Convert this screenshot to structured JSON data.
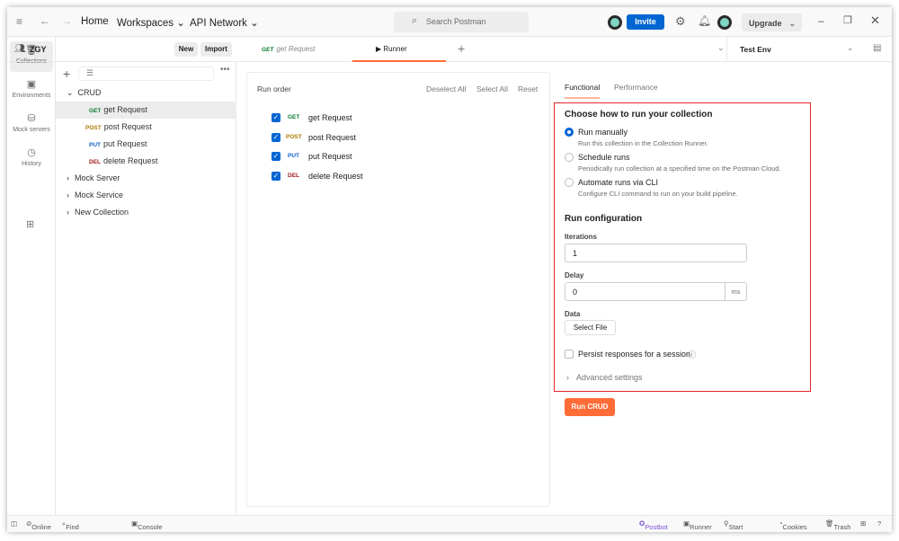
{
  "topbar": {
    "home": "Home",
    "workspaces": "Workspaces",
    "api_network": "API Network",
    "search_placeholder": "Search Postman",
    "invite": "Invite",
    "upgrade": "Upgrade"
  },
  "workspace": {
    "name": "ZGY",
    "new": "New",
    "import": "Import"
  },
  "tabs": [
    {
      "method": "GET",
      "label": "get Request"
    },
    {
      "label": "Runner"
    }
  ],
  "environment": "Test Env",
  "rail": [
    {
      "label": "Collections"
    },
    {
      "label": "Environments"
    },
    {
      "label": "Mock servers"
    },
    {
      "label": "History"
    }
  ],
  "tree": {
    "collection": "CRUD",
    "requests": [
      {
        "method": "GET",
        "name": "get Request"
      },
      {
        "method": "POST",
        "name": "post Request"
      },
      {
        "method": "PUT",
        "name": "put Request"
      },
      {
        "method": "DEL",
        "name": "delete Request"
      }
    ],
    "others": [
      "Mock Server",
      "Mock Service",
      "New Collection"
    ]
  },
  "run_order": {
    "title": "Run order",
    "deselect_all": "Deselect All",
    "select_all": "Select All",
    "reset": "Reset",
    "items": [
      {
        "method": "GET",
        "name": "get Request"
      },
      {
        "method": "POST",
        "name": "post Request"
      },
      {
        "method": "PUT",
        "name": "put Request"
      },
      {
        "method": "DEL",
        "name": "delete Request"
      }
    ]
  },
  "config": {
    "tab_functional": "Functional",
    "tab_performance": "Performance",
    "choose_title": "Choose how to run your collection",
    "options": [
      {
        "label": "Run manually",
        "desc": "Run this collection in the Collection Runner.",
        "selected": true
      },
      {
        "label": "Schedule runs",
        "desc": "Periodically run collection at a specified time on the Postman Cloud.",
        "selected": false
      },
      {
        "label": "Automate runs via CLI",
        "desc": "Configure CLI command to run on your build pipeline.",
        "selected": false
      }
    ],
    "run_config_title": "Run configuration",
    "iterations_label": "Iterations",
    "iterations": "1",
    "delay_label": "Delay",
    "delay": "0",
    "delay_unit": "ms",
    "data_label": "Data",
    "select_file": "Select File",
    "persist": "Persist responses for a session",
    "advanced": "Advanced settings",
    "run_button": "Run CRUD"
  },
  "status": {
    "online": "Online",
    "find": "Find and replace",
    "console": "Console",
    "postbot": "Postbot",
    "runner": "Runner",
    "proxy": "Start Proxy",
    "cookies": "Cookies",
    "trash": "Trash"
  }
}
